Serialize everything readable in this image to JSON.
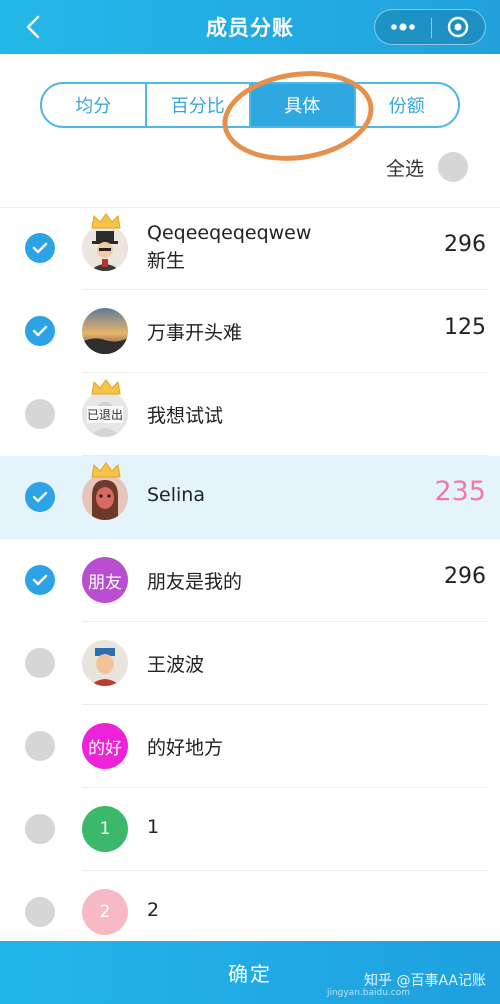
{
  "header": {
    "title": "成员分账"
  },
  "tabs": [
    {
      "label": "均分",
      "active": false
    },
    {
      "label": "百分比",
      "active": false
    },
    {
      "label": "具体",
      "active": true
    },
    {
      "label": "份额",
      "active": false
    }
  ],
  "select_all": {
    "label": "全选",
    "checked": false
  },
  "members": [
    {
      "name_line1": "Qeqeeqeqeqwew",
      "name_line2": "新生",
      "amount": "296",
      "checked": true,
      "crown": true
    },
    {
      "name": "万事开头难",
      "amount": "125",
      "checked": true,
      "crown": false
    },
    {
      "name": "我想试试",
      "amount": "",
      "checked": false,
      "crown": true,
      "badge": "已退出"
    },
    {
      "name": "Selina",
      "amount": "235",
      "checked": true,
      "crown": true,
      "highlight": true
    },
    {
      "name": "朋友是我的",
      "amount": "296",
      "checked": true,
      "crown": false,
      "avatar_text": "朋友",
      "avatar_color": "#b94fd0"
    },
    {
      "name": "王波波",
      "amount": "",
      "checked": false,
      "crown": false
    },
    {
      "name": "的好地方",
      "amount": "",
      "checked": false,
      "crown": false,
      "avatar_text": "的好",
      "avatar_color": "#ee22d8"
    },
    {
      "name": "1",
      "amount": "",
      "checked": false,
      "crown": false,
      "avatar_text": "1",
      "avatar_color": "#3bb86a"
    },
    {
      "name": "2",
      "amount": "",
      "checked": false,
      "crown": false,
      "avatar_text": "2",
      "avatar_color": "#f7b9c4"
    }
  ],
  "footer": {
    "confirm_label": "确定"
  },
  "watermark": {
    "text": "知乎 @百事AA记账",
    "sub": "jingyan.baidu.com"
  },
  "colors": {
    "accent": "#2ba3e6",
    "highlight_amount": "#ef7aa7",
    "annotation": "#e5904c"
  }
}
